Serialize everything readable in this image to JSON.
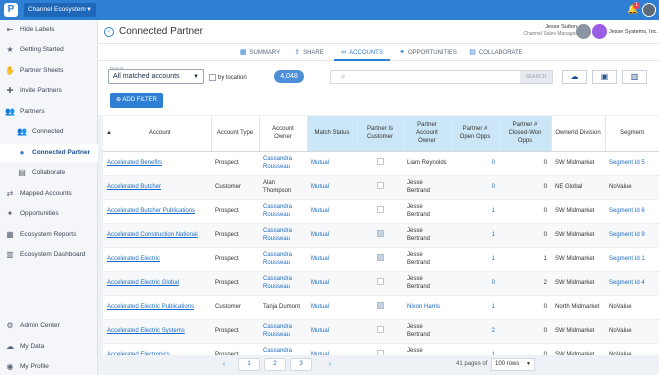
{
  "topbar": {
    "logo": "P",
    "ecosystem": "Channel Ecosystem",
    "notifications": "1"
  },
  "sidebar": {
    "items": [
      {
        "label": "Hide Labels",
        "icon": "collapse-icon"
      },
      {
        "label": "Getting Started",
        "icon": "star-icon"
      },
      {
        "label": "Partner Sheets",
        "icon": "handshake-icon"
      },
      {
        "label": "Invite Partners",
        "icon": "invite-icon"
      },
      {
        "label": "Partners",
        "icon": "partners-icon"
      },
      {
        "label": "Connected",
        "icon": "users-icon"
      },
      {
        "label": "Connected Partner",
        "icon": "user-circle-icon"
      },
      {
        "label": "Collaborate",
        "icon": "chat-icon"
      },
      {
        "label": "Mapped Accounts",
        "icon": "mapped-icon"
      },
      {
        "label": "Opportunities",
        "icon": "opportunities-icon"
      },
      {
        "label": "Ecosystem Reports",
        "icon": "reports-icon"
      },
      {
        "label": "Ecosystem Dashboard",
        "icon": "dashboard-icon"
      },
      {
        "label": "Admin Center",
        "icon": "admin-icon"
      },
      {
        "label": "My Data",
        "icon": "data-icon"
      },
      {
        "label": "My Profile",
        "icon": "profile-icon"
      }
    ]
  },
  "header": {
    "title": "Connected Partner",
    "user_name": "Jesse Sutton",
    "user_role": "Channel Sales Manager",
    "company": "Jesse Systems, Inc."
  },
  "tabs": [
    {
      "label": "SUMMARY"
    },
    {
      "label": "SHARE"
    },
    {
      "label": "ACCOUNTS"
    },
    {
      "label": "OPPORTUNITIES"
    },
    {
      "label": "COLLABORATE"
    }
  ],
  "toolbar": {
    "report_label": "Report",
    "report_value": "All matched accounts",
    "by_location": "by location",
    "count": "4,048",
    "search_placeholder": "",
    "search_button": "SEARCH",
    "add_filter": "ADD FILTER"
  },
  "table": {
    "columns": [
      "Account",
      "Account Type",
      "Account Owner",
      "Match Status",
      "Partner Is Customer",
      "Partner Account Owner",
      "Partner # Open Opps",
      "Partner # Closed-Won Opps",
      "OwnerId Division",
      "Segment"
    ],
    "rows": [
      {
        "account": "Accelerated Benefits",
        "type": "Prospect",
        "owner": "Cassandra Rousseau",
        "match": "Mutual",
        "is_customer": false,
        "partner_owner": "Liam Reynolds",
        "open": "0",
        "won": "0",
        "division": "SW Midmarket",
        "segment": "Segment Id 5"
      },
      {
        "account": "Accelerated Butcher",
        "type": "Customer",
        "owner": "Alan Thompson",
        "match": "Mutual",
        "is_customer": false,
        "partner_owner": "Jesse Bertrand",
        "open": "0",
        "won": "0",
        "division": "NE Global",
        "segment": "NoValue"
      },
      {
        "account": "Accelerated Butcher Publications",
        "type": "Prospect",
        "owner": "Cassandra Rousseau",
        "match": "Mutual",
        "is_customer": false,
        "partner_owner": "Jesse Bertrand",
        "open": "1",
        "won": "0",
        "division": "SW Midmarket",
        "segment": "Segment Id 6"
      },
      {
        "account": "Accelerated Construction National",
        "type": "Prospect",
        "owner": "Cassandra Rousseau",
        "match": "Mutual",
        "is_customer": true,
        "partner_owner": "Jesse Bertrand",
        "open": "1",
        "won": "0",
        "division": "SW Midmarket",
        "segment": "Segment Id 9"
      },
      {
        "account": "Accelerated Electric",
        "type": "Prospect",
        "owner": "Cassandra Rousseau",
        "match": "Mutual",
        "is_customer": true,
        "partner_owner": "Jesse Bertrand",
        "open": "1",
        "won": "1",
        "division": "SW Midmarket",
        "segment": "Segment Id 1"
      },
      {
        "account": "Accelerated Electric Global",
        "type": "Prospect",
        "owner": "Cassandra Rousseau",
        "match": "Mutual",
        "is_customer": false,
        "partner_owner": "Jesse Bertrand",
        "open": "0",
        "won": "2",
        "division": "SW Midmarket",
        "segment": "Segment Id 4"
      },
      {
        "account": "Accelerated Electric Publications",
        "type": "Customer",
        "owner": "Tanja Dumont",
        "match": "Mutual",
        "is_customer": true,
        "partner_owner": "Nixon Harris",
        "open": "1",
        "won": "0",
        "division": "North Midmarket",
        "segment": "NoValue"
      },
      {
        "account": "Accelerated Electric Systems",
        "type": "Prospect",
        "owner": "Cassandra Rousseau",
        "match": "Mutual",
        "is_customer": false,
        "partner_owner": "Jesse Bertrand",
        "open": "2",
        "won": "0",
        "division": "SW Midmarket",
        "segment": "NoValue"
      },
      {
        "account": "Accelerated Electronics",
        "type": "Prospect",
        "owner": "Cassandra Rousseau",
        "match": "Mutual",
        "is_customer": false,
        "partner_owner": "Jesse Bertrand",
        "open": "1",
        "won": "0",
        "division": "SW Midmarket",
        "segment": "NoValue"
      }
    ]
  },
  "pagination": {
    "pages": [
      "1",
      "2",
      "3"
    ],
    "pages_of": "41 pages of",
    "rows_per_page": "100 rows"
  }
}
